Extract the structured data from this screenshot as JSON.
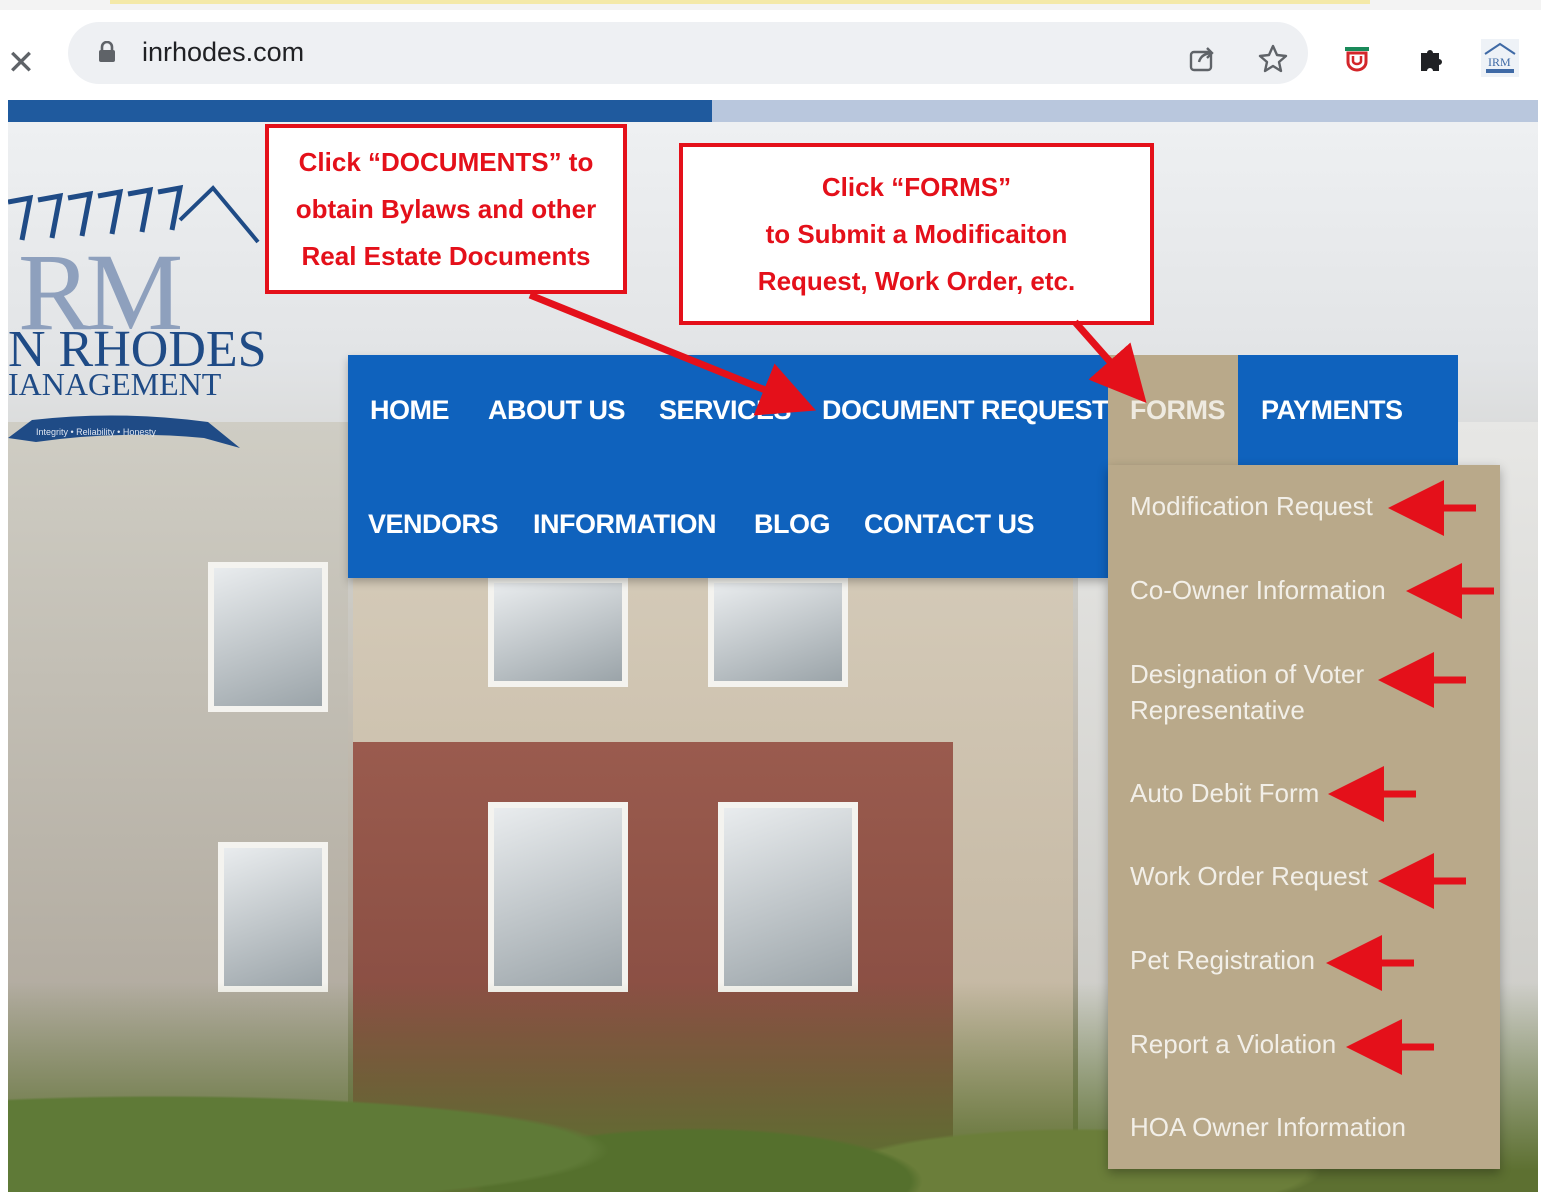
{
  "browser": {
    "url": "inrhodes.com",
    "progress_percent": 46,
    "toolbar_icons": [
      "share-icon",
      "star-icon",
      "shield-extension-icon",
      "puzzle-extension-icon",
      "profile-avatar-icon"
    ]
  },
  "logo": {
    "monogram": "RM",
    "line1": "N RHODES",
    "line2": "IANAGEMENT",
    "tagline": "Integrity • Reliability • Honesty"
  },
  "nav": {
    "row1": [
      "HOME",
      "ABOUT US",
      "SERVICES",
      "DOCUMENT REQUEST",
      "FORMS",
      "PAYMENTS"
    ],
    "row2": [
      "VENDORS",
      "INFORMATION",
      "BLOG",
      "CONTACT US"
    ],
    "active": "FORMS"
  },
  "forms_dropdown": [
    "Modification Request",
    "Co-Owner Information",
    "Designation of Voter",
    "Representative",
    "Auto Debit Form",
    "Work Order Request",
    "Pet Registration",
    "Report a Violation",
    "HOA Owner Information"
  ],
  "annotations": {
    "documents": [
      "Click “DOCUMENTS” to",
      "obtain Bylaws and other",
      "Real Estate Documents"
    ],
    "forms": [
      "Click “FORMS”",
      "to Submit a Modificaiton",
      "Request, Work Order, etc."
    ]
  },
  "colors": {
    "nav_blue": "#0f62bd",
    "dropdown_tan": "#b9a98a",
    "annotation_red": "#e4101a",
    "progress_blue": "#1f5a9e"
  }
}
